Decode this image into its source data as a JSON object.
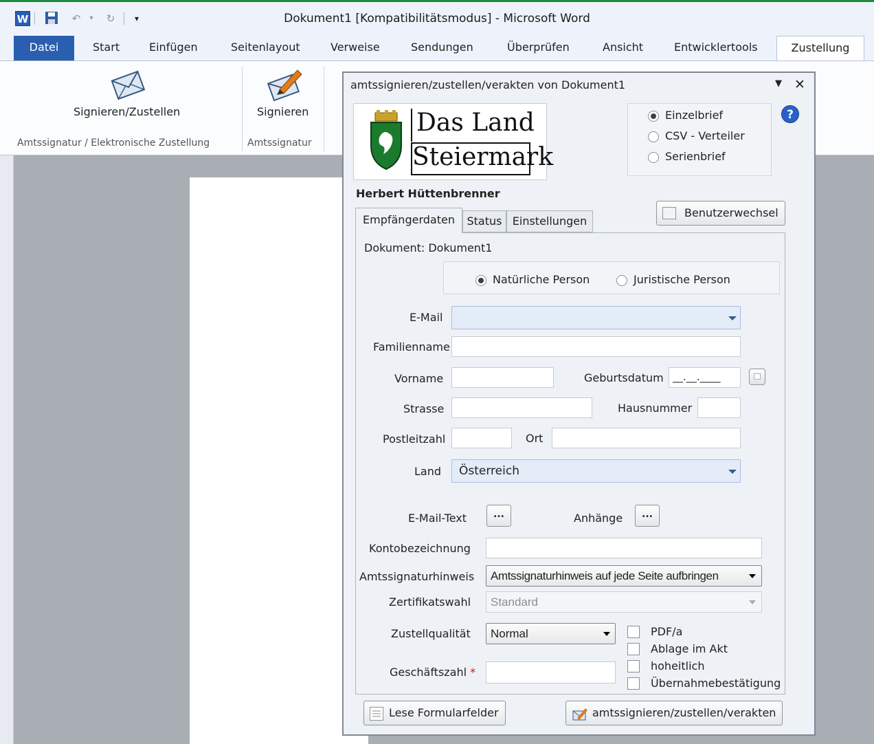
{
  "window": {
    "title": "Dokument1 [Kompatibilitätsmodus] - Microsoft Word",
    "accent_color": "#1f8a3c"
  },
  "quick_access": {
    "icons": [
      "word-icon",
      "save-icon",
      "undo-icon",
      "redo-icon",
      "customize-icon"
    ]
  },
  "ribbon": {
    "tabs": [
      "Datei",
      "Start",
      "Einfügen",
      "Seitenlayout",
      "Verweise",
      "Sendungen",
      "Überprüfen",
      "Ansicht",
      "Entwicklertools",
      "Zustellung"
    ],
    "active_tab": "Zustellung",
    "buttons": {
      "sign_deliver": "Signieren/Zustellen",
      "sign": "Signieren"
    },
    "groups": {
      "group1": "Amtssignatur / Elektronische Zustellung",
      "group2": "Amtssignatur"
    }
  },
  "dialog": {
    "title": "amtssignieren/zustellen/verakten von Dokument1",
    "logo": {
      "line1": "Das Land",
      "line2": "Steiermark"
    },
    "modes": [
      "Einzelbrief",
      "CSV - Verteiler",
      "Serienbrief"
    ],
    "selected_mode": "Einzelbrief",
    "user": "Herbert Hüttenbrenner",
    "switch_user_label": "Benutzerwechsel",
    "tabs": [
      "Empfängerdaten",
      "Status",
      "Einstellungen"
    ],
    "document_label": "Dokument: Dokument1",
    "person_types": [
      "Natürliche Person",
      "Juristische Person"
    ],
    "selected_person_type": "Natürliche Person",
    "fields": {
      "email": {
        "label": "E-Mail",
        "value": ""
      },
      "familienname": {
        "label": "Familienname",
        "value": ""
      },
      "vorname": {
        "label": "Vorname",
        "value": ""
      },
      "geburtsdatum": {
        "label": "Geburtsdatum",
        "value": "__.__.____"
      },
      "strasse": {
        "label": "Strasse",
        "value": ""
      },
      "hausnummer": {
        "label": "Hausnummer",
        "value": ""
      },
      "postleitzahl": {
        "label": "Postleitzahl",
        "value": ""
      },
      "ort": {
        "label": "Ort",
        "value": ""
      },
      "land": {
        "label": "Land",
        "value": "Österreich"
      },
      "email_text": {
        "label": "E-Mail-Text",
        "button": "..."
      },
      "anhaenge": {
        "label": "Anhänge",
        "button": "..."
      },
      "kontobezeichnung": {
        "label": "Kontobezeichnung",
        "value": ""
      },
      "amtssignaturhinweis": {
        "label": "Amtssignaturhinweis",
        "value": "Amtssignaturhinweis auf jede Seite aufbringen"
      },
      "zertifikatswahl": {
        "label": "Zertifikatswahl",
        "value": "Standard"
      },
      "zustellqualitaet": {
        "label": "Zustellqualität",
        "value": "Normal"
      },
      "geschaeftszahl": {
        "label": "Geschäftszahl",
        "required_mark": "*",
        "value": ""
      }
    },
    "checkboxes": [
      {
        "label": "PDF/a",
        "checked": false
      },
      {
        "label": "Ablage im Akt",
        "checked": false
      },
      {
        "label": "hoheitlich",
        "checked": false
      },
      {
        "label": "Übernahmebestätigung",
        "checked": false
      }
    ],
    "footer": {
      "read_fields": "Lese Formularfelder",
      "submit": "amtssignieren/zustellen/verakten"
    }
  }
}
